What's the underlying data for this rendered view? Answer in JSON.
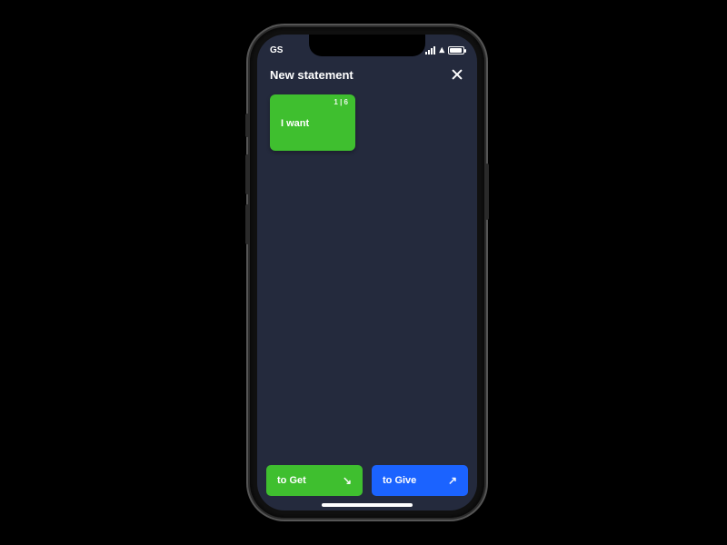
{
  "statusbar": {
    "left": "GS"
  },
  "header": {
    "title": "New statement"
  },
  "card": {
    "step": "1 | 6",
    "text": "I want"
  },
  "footer": {
    "get": {
      "label": "to Get",
      "arrow": "↘"
    },
    "give": {
      "label": "to Give",
      "arrow": "↗"
    }
  },
  "colors": {
    "screen_bg": "#242a3d",
    "green": "#3fbf2f",
    "blue": "#1b63ff"
  }
}
